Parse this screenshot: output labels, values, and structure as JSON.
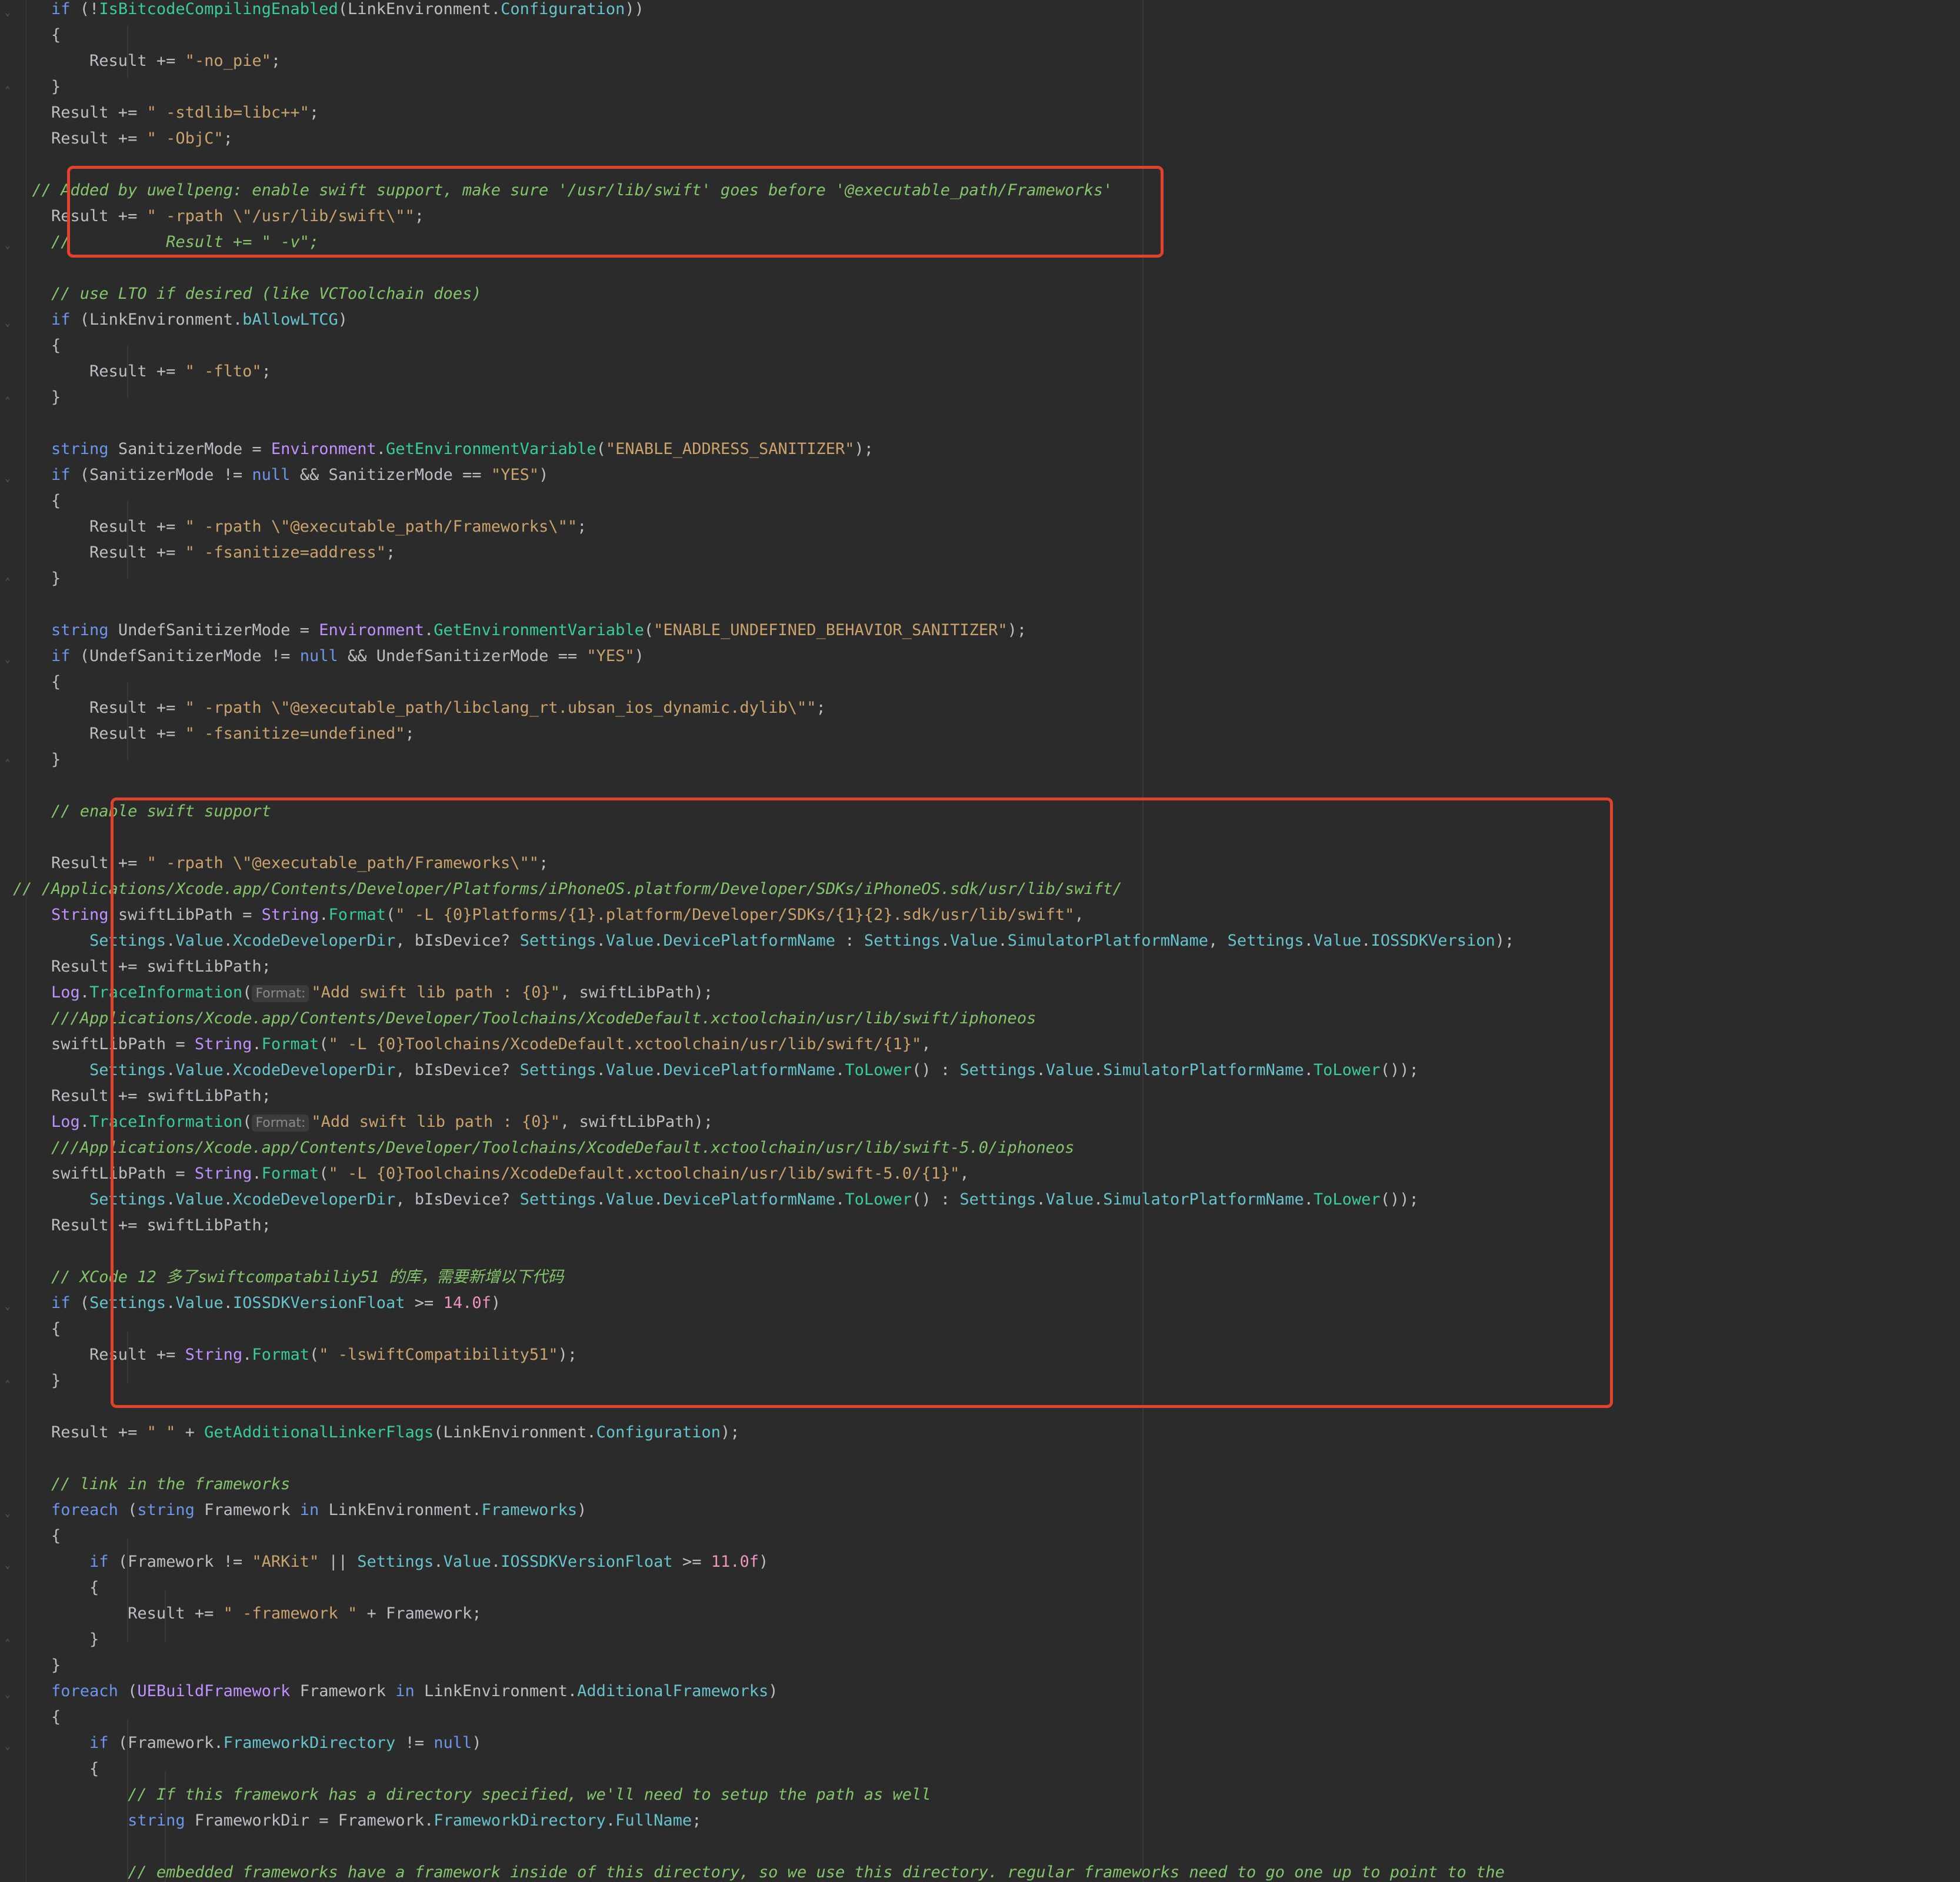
{
  "colors": {
    "background": "#2b2b2b",
    "keyword": "#6c95eb",
    "string": "#c9a26d",
    "comment": "#85c46c",
    "member": "#66c3cc",
    "type": "#c191ff",
    "method": "#39cc9b",
    "number": "#ed94c0",
    "text": "#bcbec4",
    "highlight_box": "#e0422e"
  },
  "code": {
    "lines": [
      [
        {
          "t": "\t"
        },
        {
          "t": "if",
          "c": "kw"
        },
        {
          "t": " (!"
        },
        {
          "t": "IsBitcodeCompilingEnabled",
          "c": "meth"
        },
        {
          "t": "(LinkEnvironment."
        },
        {
          "t": "Configuration",
          "c": "mem"
        },
        {
          "t": "))"
        }
      ],
      [
        {
          "t": "\t{"
        }
      ],
      [
        {
          "t": "\t\tResult += "
        },
        {
          "t": "\"-no_pie\"",
          "c": "str"
        },
        {
          "t": ";"
        }
      ],
      [
        {
          "t": "\t}"
        }
      ],
      [
        {
          "t": "\tResult += "
        },
        {
          "t": "\" -stdlib=libc++\"",
          "c": "str"
        },
        {
          "t": ";"
        }
      ],
      [
        {
          "t": "\tResult += "
        },
        {
          "t": "\" -ObjC\"",
          "c": "str"
        },
        {
          "t": ";"
        }
      ],
      [],
      [
        {
          "t": "  // Added by uwellpeng: enable swift support, make sure '/usr/lib/swift' goes before '@executable_path/Frameworks'",
          "c": "com"
        }
      ],
      [
        {
          "t": "\tResult += "
        },
        {
          "t": "\" -rpath \\\"/usr/lib/swift\\\"\"",
          "c": "str"
        },
        {
          "t": ";"
        }
      ],
      [
        {
          "t": "\t//          Result += \" -v\";",
          "c": "com"
        }
      ],
      [],
      [
        {
          "t": "\t// use LTO if desired (like VCToolchain does)",
          "c": "com"
        }
      ],
      [
        {
          "t": "\t"
        },
        {
          "t": "if",
          "c": "kw"
        },
        {
          "t": " (LinkEnvironment."
        },
        {
          "t": "bAllowLTCG",
          "c": "mem"
        },
        {
          "t": ")"
        }
      ],
      [
        {
          "t": "\t{"
        }
      ],
      [
        {
          "t": "\t\tResult += "
        },
        {
          "t": "\" -flto\"",
          "c": "str"
        },
        {
          "t": ";"
        }
      ],
      [
        {
          "t": "\t}"
        }
      ],
      [],
      [
        {
          "t": "\t"
        },
        {
          "t": "string",
          "c": "kw"
        },
        {
          "t": " SanitizerMode = "
        },
        {
          "t": "Environment",
          "c": "type"
        },
        {
          "t": "."
        },
        {
          "t": "GetEnvironmentVariable",
          "c": "meth"
        },
        {
          "t": "("
        },
        {
          "t": "\"ENABLE_ADDRESS_SANITIZER\"",
          "c": "str"
        },
        {
          "t": ");"
        }
      ],
      [
        {
          "t": "\t"
        },
        {
          "t": "if",
          "c": "kw"
        },
        {
          "t": " (SanitizerMode != "
        },
        {
          "t": "null",
          "c": "kw"
        },
        {
          "t": " && SanitizerMode == "
        },
        {
          "t": "\"YES\"",
          "c": "str"
        },
        {
          "t": ")"
        }
      ],
      [
        {
          "t": "\t{"
        }
      ],
      [
        {
          "t": "\t\tResult += "
        },
        {
          "t": "\" -rpath \\\"@executable_path/Frameworks\\\"\"",
          "c": "str"
        },
        {
          "t": ";"
        }
      ],
      [
        {
          "t": "\t\tResult += "
        },
        {
          "t": "\" -fsanitize=address\"",
          "c": "str"
        },
        {
          "t": ";"
        }
      ],
      [
        {
          "t": "\t}"
        }
      ],
      [],
      [
        {
          "t": "\t"
        },
        {
          "t": "string",
          "c": "kw"
        },
        {
          "t": " UndefSanitizerMode = "
        },
        {
          "t": "Environment",
          "c": "type"
        },
        {
          "t": "."
        },
        {
          "t": "GetEnvironmentVariable",
          "c": "meth"
        },
        {
          "t": "("
        },
        {
          "t": "\"ENABLE_UNDEFINED_BEHAVIOR_SANITIZER\"",
          "c": "str"
        },
        {
          "t": ");"
        }
      ],
      [
        {
          "t": "\t"
        },
        {
          "t": "if",
          "c": "kw"
        },
        {
          "t": " (UndefSanitizerMode != "
        },
        {
          "t": "null",
          "c": "kw"
        },
        {
          "t": " && UndefSanitizerMode == "
        },
        {
          "t": "\"YES\"",
          "c": "str"
        },
        {
          "t": ")"
        }
      ],
      [
        {
          "t": "\t{"
        }
      ],
      [
        {
          "t": "\t\tResult += "
        },
        {
          "t": "\" -rpath \\\"@executable_path/libclang_rt.ubsan_ios_dynamic.dylib\\\"\"",
          "c": "str"
        },
        {
          "t": ";"
        }
      ],
      [
        {
          "t": "\t\tResult += "
        },
        {
          "t": "\" -fsanitize=undefined\"",
          "c": "str"
        },
        {
          "t": ";"
        }
      ],
      [
        {
          "t": "\t}"
        }
      ],
      [],
      [
        {
          "t": "\t// enable swift support",
          "c": "com"
        }
      ],
      [],
      [
        {
          "t": "\tResult += "
        },
        {
          "t": "\" -rpath \\\"@executable_path/Frameworks\\\"\"",
          "c": "str"
        },
        {
          "t": ";"
        }
      ],
      [
        {
          "t": "// /Applications/Xcode.app/Contents/Developer/Platforms/iPhoneOS.platform/Developer/SDKs/iPhoneOS.sdk/usr/lib/swift/",
          "c": "com"
        }
      ],
      [
        {
          "t": "\t"
        },
        {
          "t": "String",
          "c": "type"
        },
        {
          "t": " swiftLibPath = "
        },
        {
          "t": "String",
          "c": "type"
        },
        {
          "t": "."
        },
        {
          "t": "Format",
          "c": "meth"
        },
        {
          "t": "("
        },
        {
          "t": "\" -L {0}Platforms/{1}.platform/Developer/SDKs/{1}{2}.sdk/usr/lib/swift\"",
          "c": "str"
        },
        {
          "t": ","
        }
      ],
      [
        {
          "t": "\t\t"
        },
        {
          "t": "Settings",
          "c": "mem"
        },
        {
          "t": "."
        },
        {
          "t": "Value",
          "c": "mem"
        },
        {
          "t": "."
        },
        {
          "t": "XcodeDeveloperDir",
          "c": "mem"
        },
        {
          "t": ", bIsDevice? "
        },
        {
          "t": "Settings",
          "c": "mem"
        },
        {
          "t": "."
        },
        {
          "t": "Value",
          "c": "mem"
        },
        {
          "t": "."
        },
        {
          "t": "DevicePlatformName",
          "c": "mem"
        },
        {
          "t": " : "
        },
        {
          "t": "Settings",
          "c": "mem"
        },
        {
          "t": "."
        },
        {
          "t": "Value",
          "c": "mem"
        },
        {
          "t": "."
        },
        {
          "t": "SimulatorPlatformName",
          "c": "mem"
        },
        {
          "t": ", "
        },
        {
          "t": "Settings",
          "c": "mem"
        },
        {
          "t": "."
        },
        {
          "t": "Value",
          "c": "mem"
        },
        {
          "t": "."
        },
        {
          "t": "IOSSDKVersion",
          "c": "mem"
        },
        {
          "t": ");"
        }
      ],
      [
        {
          "t": "\tResult += swiftLibPath;"
        }
      ],
      [
        {
          "t": "\t"
        },
        {
          "t": "Log",
          "c": "type"
        },
        {
          "t": "."
        },
        {
          "t": "TraceInformation",
          "c": "meth"
        },
        {
          "t": "("
        },
        {
          "t": "Format:",
          "c": "hint"
        },
        {
          "t": "\"Add swift lib path : {0}\"",
          "c": "str"
        },
        {
          "t": ", swiftLibPath);"
        }
      ],
      [
        {
          "t": "\t///Applications/Xcode.app/Contents/Developer/Toolchains/XcodeDefault.xctoolchain/usr/lib/swift/iphoneos",
          "c": "com"
        }
      ],
      [
        {
          "t": "\tswiftLibPath = "
        },
        {
          "t": "String",
          "c": "type"
        },
        {
          "t": "."
        },
        {
          "t": "Format",
          "c": "meth"
        },
        {
          "t": "("
        },
        {
          "t": "\" -L {0}Toolchains/XcodeDefault.xctoolchain/usr/lib/swift/{1}\"",
          "c": "str"
        },
        {
          "t": ","
        }
      ],
      [
        {
          "t": "\t\t"
        },
        {
          "t": "Settings",
          "c": "mem"
        },
        {
          "t": "."
        },
        {
          "t": "Value",
          "c": "mem"
        },
        {
          "t": "."
        },
        {
          "t": "XcodeDeveloperDir",
          "c": "mem"
        },
        {
          "t": ", bIsDevice? "
        },
        {
          "t": "Settings",
          "c": "mem"
        },
        {
          "t": "."
        },
        {
          "t": "Value",
          "c": "mem"
        },
        {
          "t": "."
        },
        {
          "t": "DevicePlatformName",
          "c": "mem"
        },
        {
          "t": "."
        },
        {
          "t": "ToLower",
          "c": "meth"
        },
        {
          "t": "() : "
        },
        {
          "t": "Settings",
          "c": "mem"
        },
        {
          "t": "."
        },
        {
          "t": "Value",
          "c": "mem"
        },
        {
          "t": "."
        },
        {
          "t": "SimulatorPlatformName",
          "c": "mem"
        },
        {
          "t": "."
        },
        {
          "t": "ToLower",
          "c": "meth"
        },
        {
          "t": "());"
        }
      ],
      [
        {
          "t": "\tResult += swiftLibPath;"
        }
      ],
      [
        {
          "t": "\t"
        },
        {
          "t": "Log",
          "c": "type"
        },
        {
          "t": "."
        },
        {
          "t": "TraceInformation",
          "c": "meth"
        },
        {
          "t": "("
        },
        {
          "t": "Format:",
          "c": "hint"
        },
        {
          "t": "\"Add swift lib path : {0}\"",
          "c": "str"
        },
        {
          "t": ", swiftLibPath);"
        }
      ],
      [
        {
          "t": "\t///Applications/Xcode.app/Contents/Developer/Toolchains/XcodeDefault.xctoolchain/usr/lib/swift-5.0/iphoneos",
          "c": "com"
        }
      ],
      [
        {
          "t": "\tswiftLibPath = "
        },
        {
          "t": "String",
          "c": "type"
        },
        {
          "t": "."
        },
        {
          "t": "Format",
          "c": "meth"
        },
        {
          "t": "("
        },
        {
          "t": "\" -L {0}Toolchains/XcodeDefault.xctoolchain/usr/lib/swift-5.0/{1}\"",
          "c": "str"
        },
        {
          "t": ","
        }
      ],
      [
        {
          "t": "\t\t"
        },
        {
          "t": "Settings",
          "c": "mem"
        },
        {
          "t": "."
        },
        {
          "t": "Value",
          "c": "mem"
        },
        {
          "t": "."
        },
        {
          "t": "XcodeDeveloperDir",
          "c": "mem"
        },
        {
          "t": ", bIsDevice? "
        },
        {
          "t": "Settings",
          "c": "mem"
        },
        {
          "t": "."
        },
        {
          "t": "Value",
          "c": "mem"
        },
        {
          "t": "."
        },
        {
          "t": "DevicePlatformName",
          "c": "mem"
        },
        {
          "t": "."
        },
        {
          "t": "ToLower",
          "c": "meth"
        },
        {
          "t": "() : "
        },
        {
          "t": "Settings",
          "c": "mem"
        },
        {
          "t": "."
        },
        {
          "t": "Value",
          "c": "mem"
        },
        {
          "t": "."
        },
        {
          "t": "SimulatorPlatformName",
          "c": "mem"
        },
        {
          "t": "."
        },
        {
          "t": "ToLower",
          "c": "meth"
        },
        {
          "t": "());"
        }
      ],
      [
        {
          "t": "\tResult += swiftLibPath;"
        }
      ],
      [],
      [
        {
          "t": "\t// XCode 12 多了swiftcompatabiliy51 的库，需要新增以下代码",
          "c": "com"
        }
      ],
      [
        {
          "t": "\t"
        },
        {
          "t": "if",
          "c": "kw"
        },
        {
          "t": " ("
        },
        {
          "t": "Settings",
          "c": "mem"
        },
        {
          "t": "."
        },
        {
          "t": "Value",
          "c": "mem"
        },
        {
          "t": "."
        },
        {
          "t": "IOSSDKVersionFloat",
          "c": "mem"
        },
        {
          "t": " >= "
        },
        {
          "t": "14.0f",
          "c": "num"
        },
        {
          "t": ")"
        }
      ],
      [
        {
          "t": "\t{"
        }
      ],
      [
        {
          "t": "\t\tResult += "
        },
        {
          "t": "String",
          "c": "type"
        },
        {
          "t": "."
        },
        {
          "t": "Format",
          "c": "meth"
        },
        {
          "t": "("
        },
        {
          "t": "\" -lswiftCompatibility51\"",
          "c": "str"
        },
        {
          "t": ");"
        }
      ],
      [
        {
          "t": "\t}"
        }
      ],
      [],
      [
        {
          "t": "\tResult += "
        },
        {
          "t": "\" \"",
          "c": "str"
        },
        {
          "t": " + "
        },
        {
          "t": "GetAdditionalLinkerFlags",
          "c": "meth"
        },
        {
          "t": "(LinkEnvironment."
        },
        {
          "t": "Configuration",
          "c": "mem"
        },
        {
          "t": ");"
        }
      ],
      [],
      [
        {
          "t": "\t// link in the frameworks",
          "c": "com"
        }
      ],
      [
        {
          "t": "\t"
        },
        {
          "t": "foreach",
          "c": "kw"
        },
        {
          "t": " ("
        },
        {
          "t": "string",
          "c": "kw"
        },
        {
          "t": " Framework "
        },
        {
          "t": "in",
          "c": "kw"
        },
        {
          "t": " LinkEnvironment."
        },
        {
          "t": "Frameworks",
          "c": "mem"
        },
        {
          "t": ")"
        }
      ],
      [
        {
          "t": "\t{"
        }
      ],
      [
        {
          "t": "\t\t"
        },
        {
          "t": "if",
          "c": "kw"
        },
        {
          "t": " (Framework != "
        },
        {
          "t": "\"ARKit\"",
          "c": "str"
        },
        {
          "t": " || "
        },
        {
          "t": "Settings",
          "c": "mem"
        },
        {
          "t": "."
        },
        {
          "t": "Value",
          "c": "mem"
        },
        {
          "t": "."
        },
        {
          "t": "IOSSDKVersionFloat",
          "c": "mem"
        },
        {
          "t": " >= "
        },
        {
          "t": "11.0f",
          "c": "num"
        },
        {
          "t": ")"
        }
      ],
      [
        {
          "t": "\t\t{"
        }
      ],
      [
        {
          "t": "\t\t\tResult += "
        },
        {
          "t": "\" -framework \"",
          "c": "str"
        },
        {
          "t": " + Framework;"
        }
      ],
      [
        {
          "t": "\t\t}"
        }
      ],
      [
        {
          "t": "\t}"
        }
      ],
      [
        {
          "t": "\t"
        },
        {
          "t": "foreach",
          "c": "kw"
        },
        {
          "t": " ("
        },
        {
          "t": "UEBuildFramework",
          "c": "type"
        },
        {
          "t": " Framework "
        },
        {
          "t": "in",
          "c": "kw"
        },
        {
          "t": " LinkEnvironment."
        },
        {
          "t": "AdditionalFrameworks",
          "c": "mem"
        },
        {
          "t": ")"
        }
      ],
      [
        {
          "t": "\t{"
        }
      ],
      [
        {
          "t": "\t\t"
        },
        {
          "t": "if",
          "c": "kw"
        },
        {
          "t": " (Framework."
        },
        {
          "t": "FrameworkDirectory",
          "c": "mem"
        },
        {
          "t": " != "
        },
        {
          "t": "null",
          "c": "kw"
        },
        {
          "t": ")"
        }
      ],
      [
        {
          "t": "\t\t{"
        }
      ],
      [
        {
          "t": "\t\t\t// If this framework has a directory specified, we'll need to setup the path as well",
          "c": "com"
        }
      ],
      [
        {
          "t": "\t\t\t"
        },
        {
          "t": "string",
          "c": "kw"
        },
        {
          "t": " FrameworkDir = Framework."
        },
        {
          "t": "FrameworkDirectory",
          "c": "mem"
        },
        {
          "t": "."
        },
        {
          "t": "FullName",
          "c": "mem"
        },
        {
          "t": ";"
        }
      ],
      [],
      [
        {
          "t": "\t\t\t// embedded frameworks have a framework inside of this directory, so we use this directory. regular frameworks need to go one up to point to the",
          "c": "com"
        }
      ]
    ]
  }
}
